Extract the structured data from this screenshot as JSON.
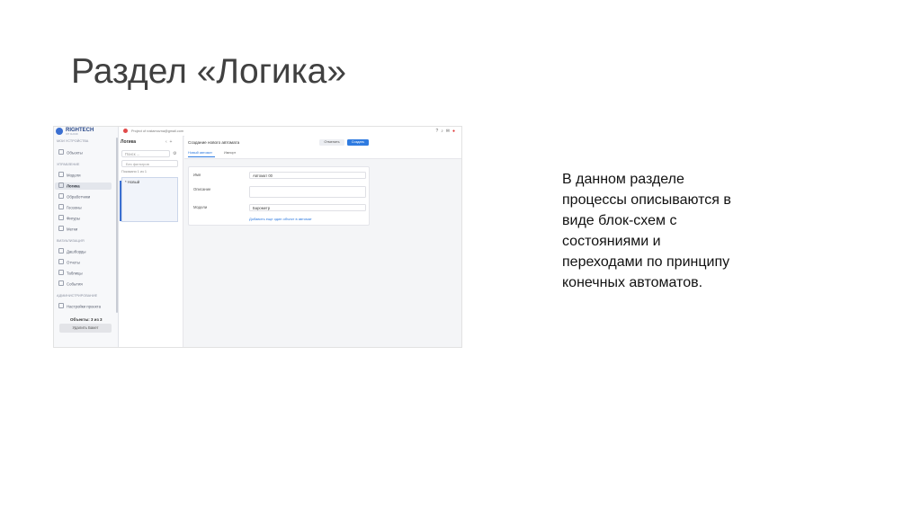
{
  "slide": {
    "title": "Раздел «Логика»",
    "description_lines": [
      "В данном разделе",
      "процессы описываются в",
      "виде блок-схем с",
      "состояниями и",
      "переходами по принципу",
      "конечных автоматов."
    ]
  },
  "app": {
    "brand": "RIGHTECH",
    "brand_sub": "IOT CLOUD",
    "topbar": {
      "email": "Project of rostamovna@gmail.com",
      "icons": [
        "help-icon",
        "bell-icon",
        "mail-icon",
        "user-icon"
      ]
    },
    "sidebar": {
      "sections": [
        {
          "label": "МОИ УСТРОЙСТВА",
          "items": [
            "Объекты"
          ]
        },
        {
          "label": "УПРАВЛЕНИЕ",
          "items": [
            "Модели",
            "Логика",
            "Обработчики",
            "Геозоны",
            "Фигуры",
            "Метки"
          ]
        },
        {
          "label": "ВИЗУАЛИЗАЦИЯ",
          "items": [
            "Дашборды",
            "Отчеты",
            "Таблицы",
            "События"
          ]
        },
        {
          "label": "АДМИНИСТРИРОВАНИЕ",
          "items": [
            "Настройки проекта"
          ]
        }
      ],
      "active_item": "Логика",
      "objects_count": "Объекты: 3 из 3",
      "delete_button": "Удалить Бакет"
    },
    "logic_panel": {
      "title": "Логика",
      "search_placeholder": "Поиск ...",
      "filter_label": "Без фильтров",
      "shown": "Показано 1 из 1",
      "items": [
        "* Новый"
      ]
    },
    "main": {
      "title": "Создание нового автомата",
      "cancel_button": "Отменить",
      "create_button": "Создать",
      "tabs": [
        "Новый автомат",
        "Импорт"
      ],
      "active_tab": "Новый автомат",
      "form": {
        "name_label": "Имя",
        "name_value": "Автомат 00",
        "description_label": "Описание",
        "description_value": "",
        "models_label": "Модели",
        "models_value": "Барометр",
        "add_link": "Добавить еще один объект в автомат"
      }
    }
  }
}
